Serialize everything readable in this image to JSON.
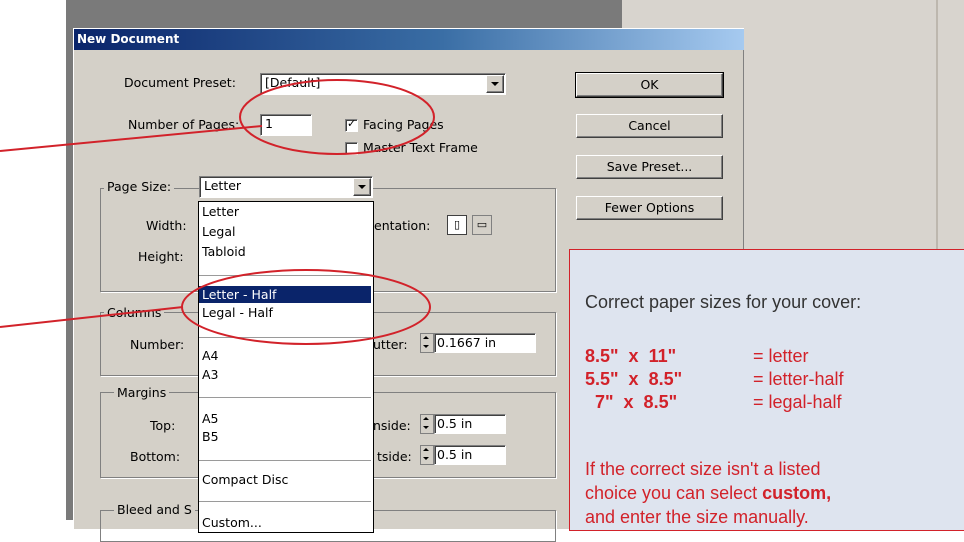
{
  "dialog": {
    "title": "New Document",
    "document_preset_label": "Document Preset:",
    "document_preset_value": "[Default]",
    "number_of_pages_label": "Number of Pages:",
    "number_of_pages_value": "1",
    "facing_pages_label": "Facing Pages",
    "facing_pages_checked": true,
    "master_text_frame_label": "Master Text Frame",
    "master_text_frame_checked": false,
    "page_size_label": "Page Size:",
    "page_size_value": "Letter",
    "width_label": "Width:",
    "height_label": "Height:",
    "orientation_label": "entation:",
    "columns_label": "Columns",
    "column_number_label": "Number:",
    "gutter_label": "utter:",
    "gutter_value": "0.1667 in",
    "margins_label": "Margins",
    "top_label": "Top:",
    "bottom_label": "Bottom:",
    "inside_label": "nside:",
    "inside_value": "0.5 in",
    "outside_label": "tside:",
    "outside_value": "0.5 in",
    "bleed_label": "Bleed and S"
  },
  "buttons": {
    "ok": "OK",
    "cancel": "Cancel",
    "save_preset": "Save Preset...",
    "fewer_options": "Fewer Options"
  },
  "page_size_options": [
    "Letter",
    "Legal",
    "Tabloid",
    "Letter - Half",
    "Legal - Half",
    "A4",
    "A3",
    "A5",
    "B5",
    "Compact Disc",
    "Custom..."
  ],
  "selected_option": "Letter - Half",
  "callout": {
    "heading": "Correct paper sizes for your cover:",
    "rows": [
      {
        "size": "8.5\"  x  11\"",
        "name": "= letter"
      },
      {
        "size": "5.5\"  x  8.5\"",
        "name": "= letter-half"
      },
      {
        "size": "  7\"  x  8.5\"",
        "name": "= legal-half"
      }
    ],
    "note_line1": "If the correct size isn't a listed",
    "note_line2_plain": "choice you can select ",
    "note_line2_bold": "custom,",
    "note_line3": "and enter the size manually."
  },
  "colors": {
    "accent_red": "#d2222a",
    "callout_bg": "#dee4ef",
    "selection": "#0a246a",
    "dialog_face": "#d4d0c8"
  }
}
